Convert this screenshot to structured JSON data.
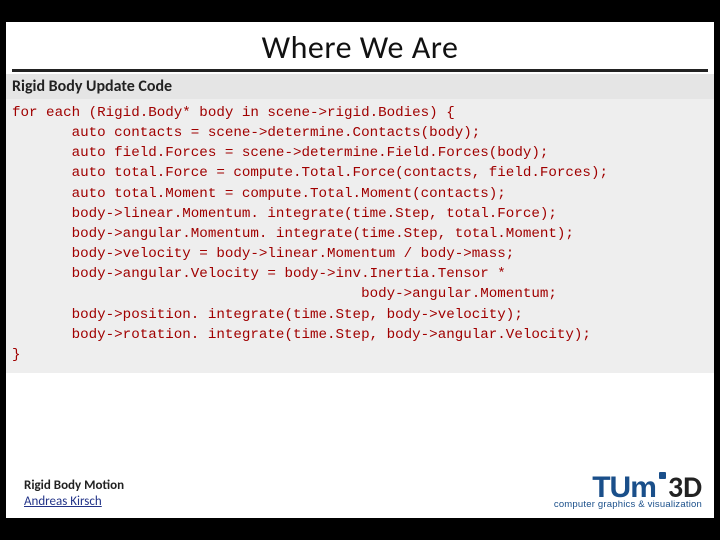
{
  "title": "Where We Are",
  "section_header": "Rigid Body Update Code",
  "code": "for each (Rigid.Body* body in scene->rigid.Bodies) {\n       auto contacts = scene->determine.Contacts(body);\n       auto field.Forces = scene->determine.Field.Forces(body);\n       auto total.Force = compute.Total.Force(contacts, field.Forces);\n       auto total.Moment = compute.Total.Moment(contacts);\n       body->linear.Momentum. integrate(time.Step, total.Force);\n       body->angular.Momentum. integrate(time.Step, total.Moment);\n       body->velocity = body->linear.Momentum / body->mass;\n       body->angular.Velocity = body->inv.Inertia.Tensor *\n                                         body->angular.Momentum;\n       body->position. integrate(time.Step, body->velocity);\n       body->rotation. integrate(time.Step, body->angular.Velocity);\n}",
  "footer": {
    "topic": "Rigid Body Motion",
    "author": "Andreas Kirsch",
    "logo_main": "TUm",
    "logo_suffix": "3D",
    "tagline": "computer graphics & visualization"
  }
}
